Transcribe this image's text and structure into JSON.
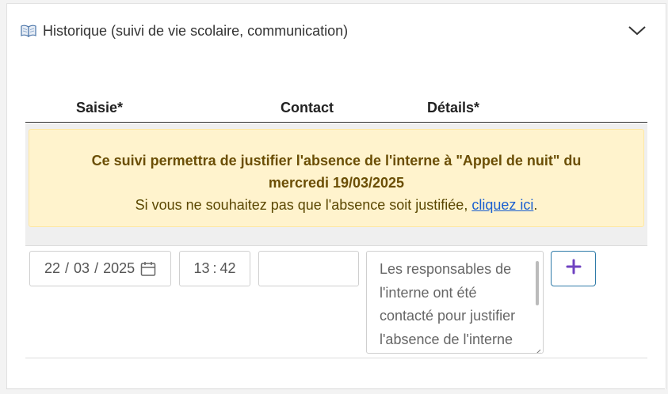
{
  "accordion": {
    "icon": "open-book-icon",
    "title": "Historique (suivi de vie scolaire, communication)",
    "toggle_icon": "chevron-down-icon"
  },
  "table": {
    "headers": [
      "Saisie*",
      "Contact",
      "Détails*"
    ]
  },
  "alert": {
    "strong_text": "Ce suivi permettra de justifier l'absence de l'interne à \"Appel de nuit\" du mercredi 19/03/2025",
    "note_prefix": "Si vous ne souhaitez pas que l'absence soit justifiée, ",
    "link_text": "cliquez ici",
    "note_suffix": ".",
    "colors": {
      "background": "#fff3cd",
      "text": "#6b4e05",
      "link": "#1a5fd0"
    }
  },
  "form": {
    "date": {
      "day": "22",
      "month": "03",
      "year": "2025",
      "icon": "calendar-icon"
    },
    "time": {
      "hour": "13",
      "minute": "42"
    },
    "contact": {
      "value": ""
    },
    "details": {
      "value": "Les responsables de l'interne ont été contacté pour justifier l'absence de l'interne"
    },
    "add_button": {
      "icon": "plus-icon",
      "color": "#6f42c1"
    }
  }
}
